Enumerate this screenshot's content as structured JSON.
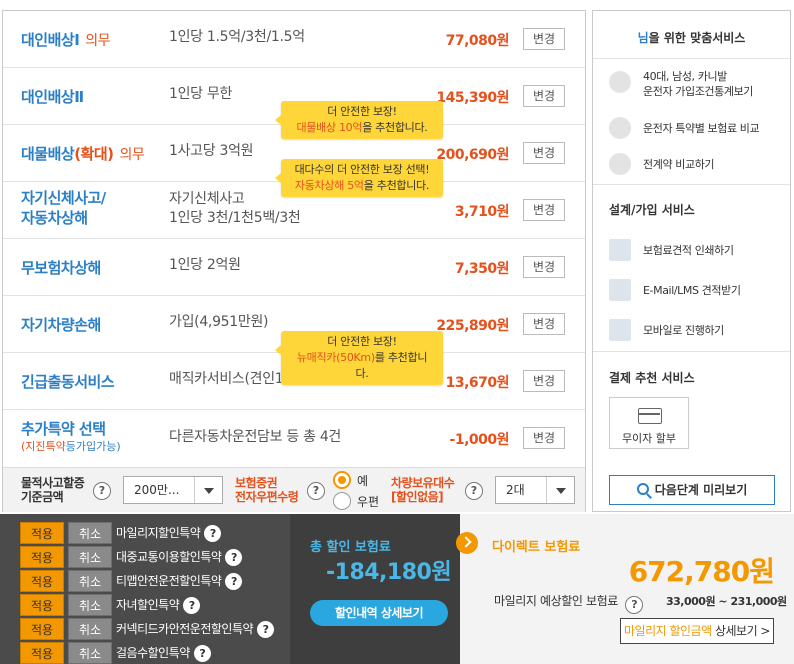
{
  "coverages": [
    {
      "name": "대인배상Ⅰ",
      "required": "의무",
      "desc": "1인당 1.5억/3천/1.5억",
      "price": "77,080원",
      "btn": "변경"
    },
    {
      "name": "대인배상Ⅱ",
      "required": "",
      "desc": "1인당 무한",
      "price": "145,390원",
      "btn": "변경"
    },
    {
      "name_a": "대물배상",
      "name_b": "(확대)",
      "required": "의무",
      "desc": "1사고당 3억원",
      "price": "200,690원",
      "btn": "변경"
    },
    {
      "name_line1": "자기신체사고/",
      "name_line2": "자동차상해",
      "desc_line1": "자기신체사고",
      "desc_line2": "1인당 3천/1천5백/3천",
      "price": "3,710원",
      "btn": "변경"
    },
    {
      "name": "무보험차상해",
      "desc": "1인당 2억원",
      "price": "7,350원",
      "btn": "변경"
    },
    {
      "name": "자기차량손해",
      "desc": "가입(4,951만원)",
      "price": "225,890원",
      "btn": "변경"
    },
    {
      "name": "긴급출동서비스",
      "desc": "매직카서비스(견인10Km)",
      "price": "13,670원",
      "btn": "변경"
    },
    {
      "name": "추가특약 선택",
      "sub_a": "(지진특약",
      "sub_b": "등가입가능)",
      "desc": "다른자동차운전담보 등 총 4건",
      "price": "-1,000원",
      "btn": "변경"
    }
  ],
  "tooltips": [
    {
      "line1": "더 안전한 보장!",
      "hl": "대물배상 10억",
      "rest": "을 추천합니다."
    },
    {
      "line1": "대다수의 더 안전한 보장 선택!",
      "hl": "자동차상해 5억",
      "rest": "을 추천합니다."
    },
    {
      "line1": "더 안전한 보장!",
      "hl": "뉴매직카(50Km)",
      "rest": "를 추천합니다."
    }
  ],
  "settings": {
    "property_label_1": "물적사고할증",
    "property_label_2": "기준금액",
    "property_value": "200만...",
    "cert_label_1": "보험증권",
    "cert_label_2": "전자우편수령",
    "radio_yes": "예",
    "radio_mail": "우편",
    "cars_label_1": "차량보유대수",
    "cars_label_2": "[할인없음]",
    "cars_value": "2대",
    "help": "?"
  },
  "side": {
    "header_hl": "님",
    "header_rest": "을 위한 맞춤서비스",
    "profile_line1": "40대, 남성, 카니발",
    "profile_line2": "운전자 가입조건통계보기",
    "item_special": "운전자 특약별 보험료 비교",
    "item_prev": "전계약 비교하기",
    "section_design": "설계/가입 서비스",
    "item_print": "보험료견적 인쇄하기",
    "item_email": "E-Mail/LMS 견적받기",
    "item_mobile": "모바일로 진행하기",
    "section_pay": "결제 추천 서비스",
    "no_interest": "무이자 할부",
    "next_btn": "다음단계 미리보기"
  },
  "discounts": [
    {
      "apply": "적용",
      "cancel": "취소",
      "name": "마일리지할인특약",
      "help": "?"
    },
    {
      "apply": "적용",
      "cancel": "취소",
      "name": "대중교통이용할인특약",
      "help": "?"
    },
    {
      "apply": "적용",
      "cancel": "취소",
      "name": "티맵안전운전할인특약",
      "help": "?"
    },
    {
      "apply": "적용",
      "cancel": "취소",
      "name": "자녀할인특약",
      "help": "?"
    },
    {
      "apply": "적용",
      "cancel": "취소",
      "name": "커넥티드카안전운전할인특약",
      "help": "?"
    },
    {
      "apply": "적용",
      "cancel": "취소",
      "name": "걸음수할인특약",
      "help": "?"
    }
  ],
  "summary": {
    "total_discount_label": "총 할인 보험료",
    "total_discount_value": "-184,180원",
    "discount_detail_btn": "할인내역 상세보기",
    "direct_label": "다이렉트 보험료",
    "direct_value": "672,780원",
    "mileage_label": "마일리지 예상할인 보험료",
    "mileage_help": "?",
    "mileage_range": "33,000원 ~ 231,000원",
    "mileage_btn_hl": "마일리지 할인금액",
    "mileage_btn_rest": " 상세보기 >"
  },
  "colors": {
    "accent_blue": "#2c7fc6",
    "accent_orange": "#e5501b",
    "brand_orange": "#f39800",
    "tooltip_yellow": "#ffd63a"
  }
}
